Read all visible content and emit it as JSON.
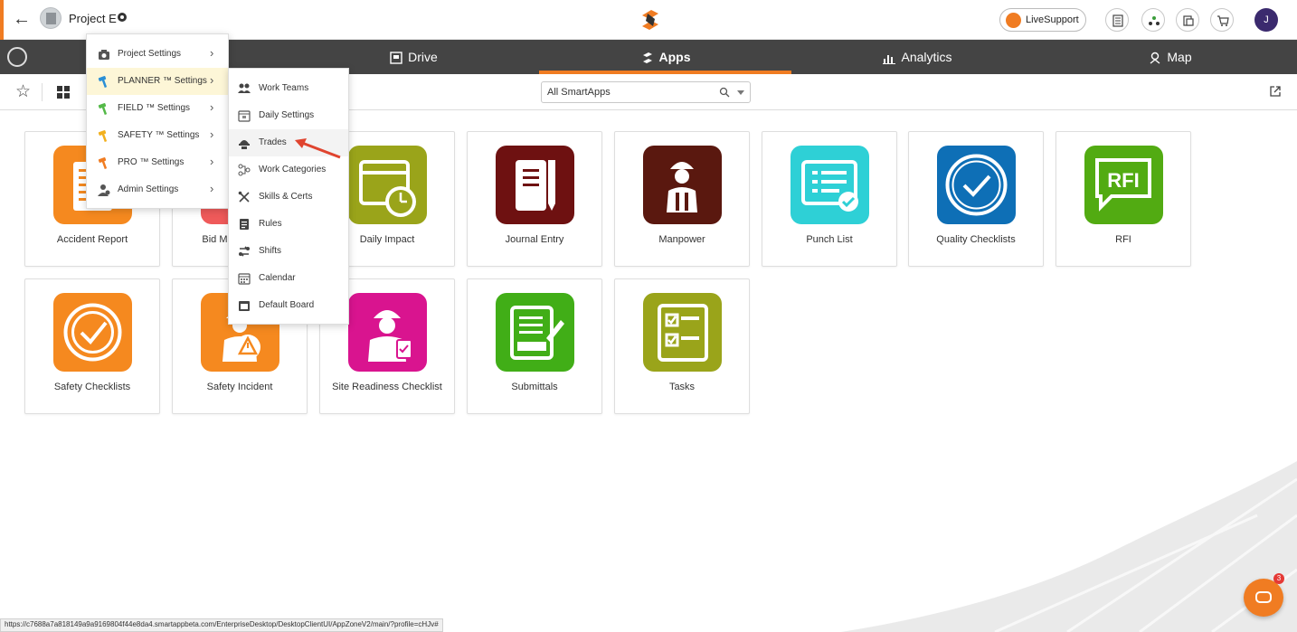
{
  "header": {
    "project_name": "Project E",
    "livesupport_label": "LiveSupport",
    "avatar_initial": "J"
  },
  "nav": {
    "tabs": [
      {
        "label": "Drive",
        "icon": "drive-icon"
      },
      {
        "label": "Apps",
        "icon": "apps-icon",
        "active": true
      },
      {
        "label": "Analytics",
        "icon": "analytics-icon"
      },
      {
        "label": "Map",
        "icon": "map-icon"
      }
    ]
  },
  "toolbar": {
    "filter_value": "All SmartApps"
  },
  "apps": [
    {
      "label": "Accident Report",
      "color": "#f5891f",
      "icon": "accident-report-icon"
    },
    {
      "label": "Bid Management",
      "color": "#ef5a5a",
      "icon": "bid-icon"
    },
    {
      "label": "Daily Impact",
      "color": "#9aa41a",
      "icon": "calendar-clock-icon"
    },
    {
      "label": "Journal Entry",
      "color": "#6e1111",
      "icon": "journal-icon"
    },
    {
      "label": "Manpower",
      "color": "#5a180f",
      "icon": "worker-icon"
    },
    {
      "label": "Punch List",
      "color": "#2ed0d6",
      "icon": "punch-list-icon"
    },
    {
      "label": "Quality Checklists",
      "color": "#0e6fb6",
      "icon": "quality-check-icon"
    },
    {
      "label": "RFI",
      "color": "#52ab12",
      "icon": "rfi-icon"
    },
    {
      "label": "Safety Checklists",
      "color": "#f5891f",
      "icon": "badge-check-icon"
    },
    {
      "label": "Safety Incident",
      "color": "#f5891f",
      "icon": "safety-incident-icon"
    },
    {
      "label": "Site Readiness Checklist",
      "color": "#d9148f",
      "icon": "site-worker-icon"
    },
    {
      "label": "Submittals",
      "color": "#41ae17",
      "icon": "submittal-icon"
    },
    {
      "label": "Tasks",
      "color": "#9aa41a",
      "icon": "tasks-icon"
    }
  ],
  "settings_menu": {
    "items": [
      {
        "label": "Project Settings",
        "icon": "camera-icon",
        "icon_color": "#555555"
      },
      {
        "label": "PLANNER ™ Settings",
        "icon": "planner-hammer-icon",
        "icon_color": "#2a8fd6",
        "active": true
      },
      {
        "label": "FIELD ™ Settings",
        "icon": "field-hammer-icon",
        "icon_color": "#54b948"
      },
      {
        "label": "SAFETY ™ Settings",
        "icon": "safety-hammer-icon",
        "icon_color": "#f2b01e"
      },
      {
        "label": "PRO ™ Settings",
        "icon": "pro-hammer-icon",
        "icon_color": "#f07c22"
      },
      {
        "label": "Admin Settings",
        "icon": "admin-user-icon",
        "icon_color": "#555555"
      }
    ]
  },
  "planner_submenu": {
    "items": [
      {
        "label": "Work Teams",
        "icon": "people-icon"
      },
      {
        "label": "Daily Settings",
        "icon": "calendar-day-icon"
      },
      {
        "label": "Trades",
        "icon": "hardhat-icon",
        "hover": true
      },
      {
        "label": "Work Categories",
        "icon": "categories-icon"
      },
      {
        "label": "Skills & Certs",
        "icon": "tools-icon"
      },
      {
        "label": "Rules",
        "icon": "rules-doc-icon"
      },
      {
        "label": "Shifts",
        "icon": "shift-icon"
      },
      {
        "label": "Calendar",
        "icon": "calendar-icon"
      },
      {
        "label": "Default Board",
        "icon": "board-icon"
      }
    ]
  },
  "status_bar": {
    "url": "https://c7688a7a818149a9a9169804f44e8da4.smartappbeta.com/EnterpriseDesktop/DesktopClientUI/AppZoneV2/main/?profile=cHJv#"
  },
  "chat": {
    "badge_count": "3"
  },
  "colors": {
    "accent": "#f07c22",
    "navbar": "#444444"
  }
}
